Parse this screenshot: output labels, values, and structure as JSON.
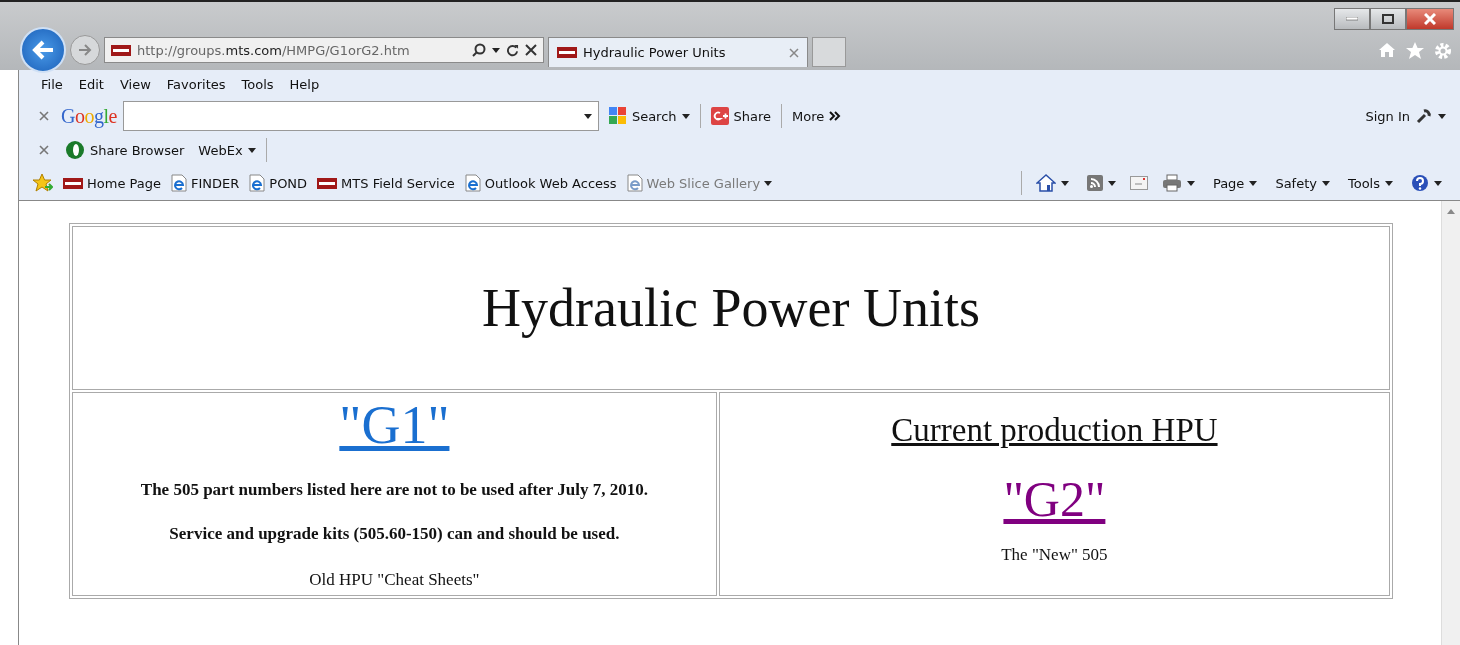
{
  "browser": {
    "address": "http://groups.**mts.com**/HMPG/G1orG2.htm",
    "tabs": [
      {
        "label": "Hydraulic Power Units",
        "selected": true
      }
    ],
    "menu": [
      "File",
      "Edit",
      "View",
      "Favorites",
      "Tools",
      "Help"
    ],
    "google_bar": {
      "logo": "Google",
      "search": "Search",
      "share": "Share",
      "more": "More",
      "sign_in": "Sign In"
    },
    "links_bar": [
      {
        "label": "Share Browser",
        "kind": "logo"
      },
      {
        "label": "WebEx",
        "kind": "menu"
      }
    ],
    "favorites": [
      {
        "label": "Home Page",
        "kind": "mts"
      },
      {
        "label": "FINDER",
        "kind": "page"
      },
      {
        "label": "POND",
        "kind": "page"
      },
      {
        "label": "MTS Field Service",
        "kind": "mts"
      },
      {
        "label": "Outlook Web Access",
        "kind": "page"
      },
      {
        "label": "Web Slice Gallery",
        "kind": "gallery"
      }
    ],
    "command_bar": [
      "Page",
      "Safety",
      "Tools"
    ]
  },
  "page": {
    "title": "Hydraulic Power Units",
    "left": {
      "link": "\"G1\"",
      "notes": [
        "The 505 part numbers listed here are not to be used after July 7, 2010.",
        "Service and upgrade kits (505.60-150) can and should be used."
      ],
      "caption": "Old HPU \"Cheat Sheets\""
    },
    "right": {
      "heading": "Current production HPU",
      "link": "\"G2\"",
      "caption": "The \"New\" 505"
    }
  }
}
